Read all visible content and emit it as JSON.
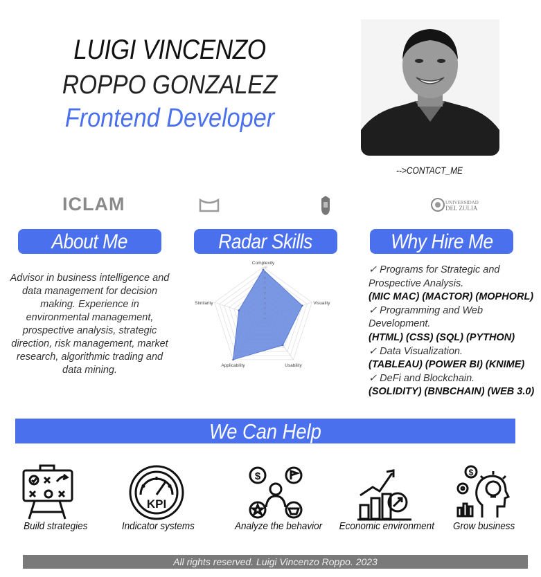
{
  "header": {
    "name_line1": "LUIGI VINCENZO",
    "name_line2": "ROPPO GONZALEZ",
    "role": "Frontend Developer",
    "contact_link": "-->CONTACT_ME"
  },
  "logos": {
    "iclam": "ICLAM",
    "university_line1": "UNIVERSIDAD",
    "university_line2": "DEL ZULIA"
  },
  "sections": {
    "about_title": "About Me",
    "radar_title": "Radar Skills",
    "hire_title": "Why Hire Me"
  },
  "about_text": "Advisor in business intelligence and data management for decision making. Experience in environmental management, prospective analysis, strategic direction, risk management, market research, algorithmic trading and data mining.",
  "why_hire": [
    {
      "line": "✓ Programs for Strategic and Prospective Analysis.",
      "tools": "(MIC MAC) (MACTOR) (MOPHORL)"
    },
    {
      "line": "✓ Programming and Web Development.",
      "tools": "(HTML) (CSS) (SQL) (PYTHON)"
    },
    {
      "line": "✓ Data Visualization.",
      "tools": "(TABLEAU) (POWER BI) (KNIME)"
    },
    {
      "line": "✓ DeFi and Blockchain.",
      "tools": "(SOLIDITY) (BNBCHAIN) (WEB 3.0)"
    }
  ],
  "chart_data": {
    "type": "radar",
    "categories": [
      "Complexity",
      "Visuality",
      "Usability",
      "Applicability",
      "Similarity"
    ],
    "values": [
      9.5,
      8,
      6.5,
      10,
      5
    ],
    "ylim": [
      0,
      10
    ],
    "ticks": [
      "0",
      "1",
      "2",
      "3",
      "4",
      "5",
      "6",
      "7",
      "8",
      "9",
      "10"
    ],
    "grid": true,
    "color": "#6a8cdf"
  },
  "help": {
    "title": "We Can Help",
    "services": [
      {
        "label": "Build strategies",
        "icon": "strategy-board-icon"
      },
      {
        "label": "Indicator systems",
        "icon": "kpi-gauge-icon"
      },
      {
        "label": "Analyze the behavior",
        "icon": "consumer-behavior-icon"
      },
      {
        "label": "Economic environment",
        "icon": "growth-chart-icon"
      },
      {
        "label": "Grow business",
        "icon": "business-idea-icon"
      }
    ]
  },
  "footer": "All rights reserved. Luigi Vincenzo Roppo. 2023",
  "colors": {
    "accent": "#4a70ee",
    "footer_bg": "#7a7a7a",
    "radar_fill": "#6a8cdf"
  }
}
